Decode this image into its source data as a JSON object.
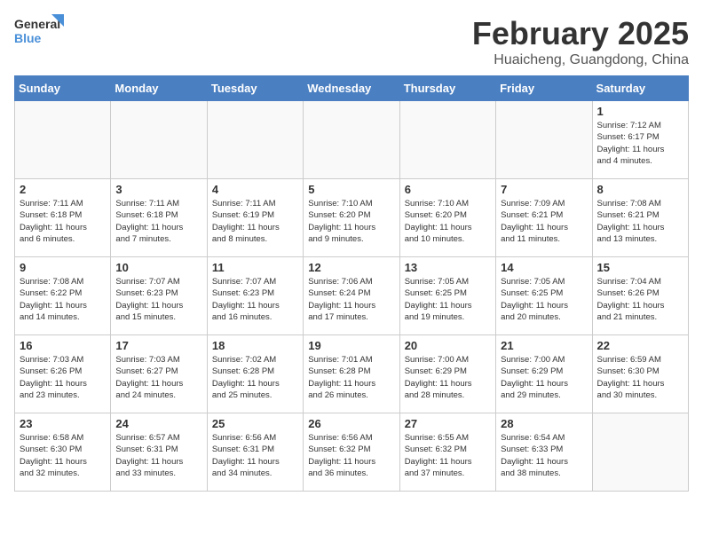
{
  "logo": {
    "line1": "General",
    "line2": "Blue"
  },
  "title": "February 2025",
  "subtitle": "Huaicheng, Guangdong, China",
  "weekdays": [
    "Sunday",
    "Monday",
    "Tuesday",
    "Wednesday",
    "Thursday",
    "Friday",
    "Saturday"
  ],
  "weeks": [
    [
      {
        "day": "",
        "info": ""
      },
      {
        "day": "",
        "info": ""
      },
      {
        "day": "",
        "info": ""
      },
      {
        "day": "",
        "info": ""
      },
      {
        "day": "",
        "info": ""
      },
      {
        "day": "",
        "info": ""
      },
      {
        "day": "1",
        "info": "Sunrise: 7:12 AM\nSunset: 6:17 PM\nDaylight: 11 hours\nand 4 minutes."
      }
    ],
    [
      {
        "day": "2",
        "info": "Sunrise: 7:11 AM\nSunset: 6:18 PM\nDaylight: 11 hours\nand 6 minutes."
      },
      {
        "day": "3",
        "info": "Sunrise: 7:11 AM\nSunset: 6:18 PM\nDaylight: 11 hours\nand 7 minutes."
      },
      {
        "day": "4",
        "info": "Sunrise: 7:11 AM\nSunset: 6:19 PM\nDaylight: 11 hours\nand 8 minutes."
      },
      {
        "day": "5",
        "info": "Sunrise: 7:10 AM\nSunset: 6:20 PM\nDaylight: 11 hours\nand 9 minutes."
      },
      {
        "day": "6",
        "info": "Sunrise: 7:10 AM\nSunset: 6:20 PM\nDaylight: 11 hours\nand 10 minutes."
      },
      {
        "day": "7",
        "info": "Sunrise: 7:09 AM\nSunset: 6:21 PM\nDaylight: 11 hours\nand 11 minutes."
      },
      {
        "day": "8",
        "info": "Sunrise: 7:08 AM\nSunset: 6:21 PM\nDaylight: 11 hours\nand 13 minutes."
      }
    ],
    [
      {
        "day": "9",
        "info": "Sunrise: 7:08 AM\nSunset: 6:22 PM\nDaylight: 11 hours\nand 14 minutes."
      },
      {
        "day": "10",
        "info": "Sunrise: 7:07 AM\nSunset: 6:23 PM\nDaylight: 11 hours\nand 15 minutes."
      },
      {
        "day": "11",
        "info": "Sunrise: 7:07 AM\nSunset: 6:23 PM\nDaylight: 11 hours\nand 16 minutes."
      },
      {
        "day": "12",
        "info": "Sunrise: 7:06 AM\nSunset: 6:24 PM\nDaylight: 11 hours\nand 17 minutes."
      },
      {
        "day": "13",
        "info": "Sunrise: 7:05 AM\nSunset: 6:25 PM\nDaylight: 11 hours\nand 19 minutes."
      },
      {
        "day": "14",
        "info": "Sunrise: 7:05 AM\nSunset: 6:25 PM\nDaylight: 11 hours\nand 20 minutes."
      },
      {
        "day": "15",
        "info": "Sunrise: 7:04 AM\nSunset: 6:26 PM\nDaylight: 11 hours\nand 21 minutes."
      }
    ],
    [
      {
        "day": "16",
        "info": "Sunrise: 7:03 AM\nSunset: 6:26 PM\nDaylight: 11 hours\nand 23 minutes."
      },
      {
        "day": "17",
        "info": "Sunrise: 7:03 AM\nSunset: 6:27 PM\nDaylight: 11 hours\nand 24 minutes."
      },
      {
        "day": "18",
        "info": "Sunrise: 7:02 AM\nSunset: 6:28 PM\nDaylight: 11 hours\nand 25 minutes."
      },
      {
        "day": "19",
        "info": "Sunrise: 7:01 AM\nSunset: 6:28 PM\nDaylight: 11 hours\nand 26 minutes."
      },
      {
        "day": "20",
        "info": "Sunrise: 7:00 AM\nSunset: 6:29 PM\nDaylight: 11 hours\nand 28 minutes."
      },
      {
        "day": "21",
        "info": "Sunrise: 7:00 AM\nSunset: 6:29 PM\nDaylight: 11 hours\nand 29 minutes."
      },
      {
        "day": "22",
        "info": "Sunrise: 6:59 AM\nSunset: 6:30 PM\nDaylight: 11 hours\nand 30 minutes."
      }
    ],
    [
      {
        "day": "23",
        "info": "Sunrise: 6:58 AM\nSunset: 6:30 PM\nDaylight: 11 hours\nand 32 minutes."
      },
      {
        "day": "24",
        "info": "Sunrise: 6:57 AM\nSunset: 6:31 PM\nDaylight: 11 hours\nand 33 minutes."
      },
      {
        "day": "25",
        "info": "Sunrise: 6:56 AM\nSunset: 6:31 PM\nDaylight: 11 hours\nand 34 minutes."
      },
      {
        "day": "26",
        "info": "Sunrise: 6:56 AM\nSunset: 6:32 PM\nDaylight: 11 hours\nand 36 minutes."
      },
      {
        "day": "27",
        "info": "Sunrise: 6:55 AM\nSunset: 6:32 PM\nDaylight: 11 hours\nand 37 minutes."
      },
      {
        "day": "28",
        "info": "Sunrise: 6:54 AM\nSunset: 6:33 PM\nDaylight: 11 hours\nand 38 minutes."
      },
      {
        "day": "",
        "info": ""
      }
    ]
  ]
}
